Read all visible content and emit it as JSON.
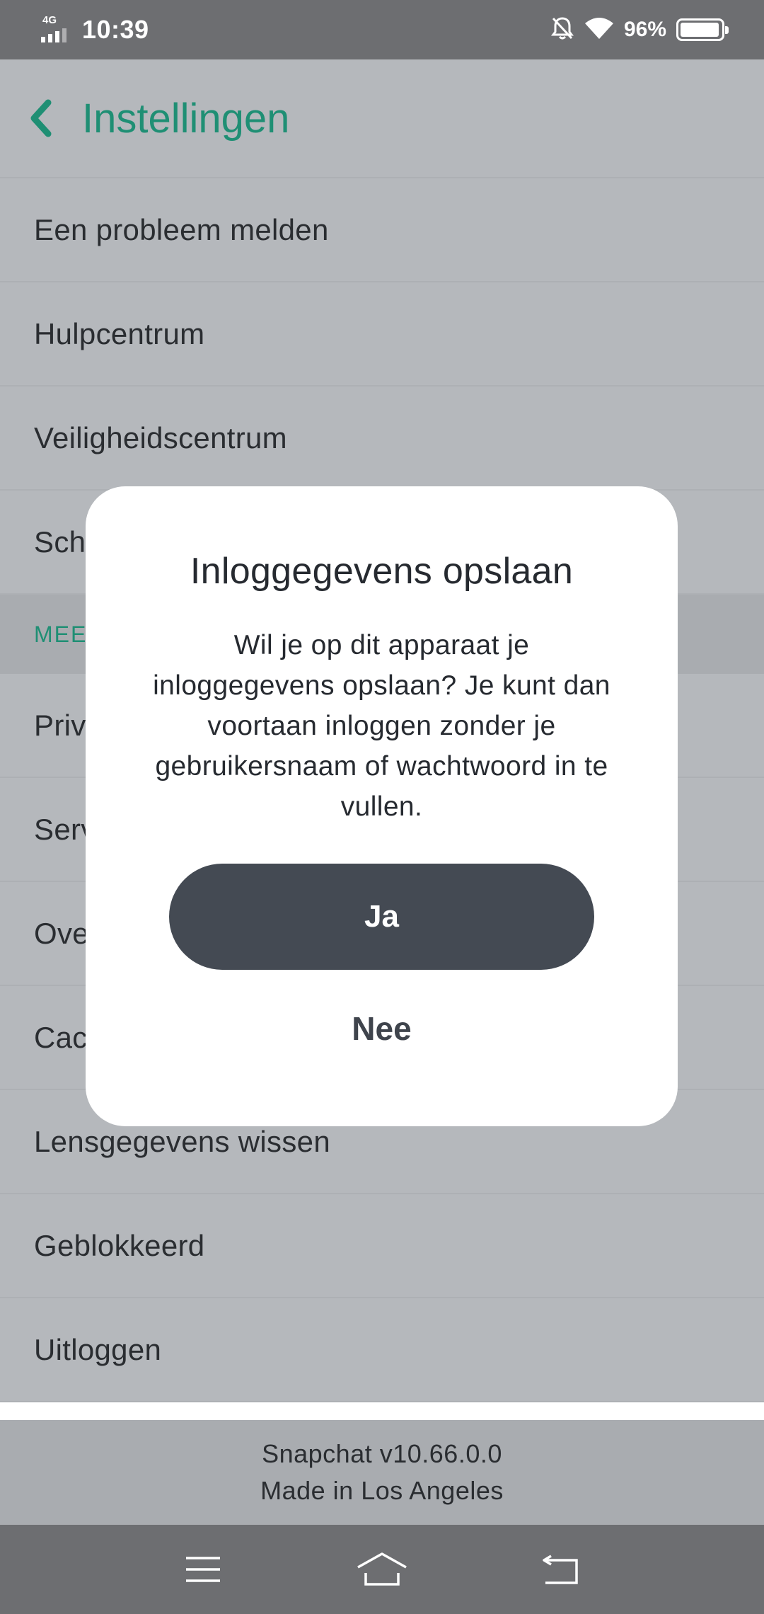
{
  "status_bar": {
    "network": "4G",
    "time": "10:39",
    "battery_percent": "96%",
    "battery_level": 0.96,
    "icons": [
      "signal-icon",
      "bell-off-icon",
      "wifi-icon",
      "battery-icon"
    ]
  },
  "header": {
    "title": "Instellingen",
    "back_icon": "chevron-left-icon"
  },
  "list": {
    "rows_top": [
      "Een probleem melden",
      "Hulpcentrum",
      "Veiligheidscentrum",
      "Sch"
    ],
    "section_header": "MEE",
    "rows_bottom": [
      "Priv",
      "Serv",
      "Ove",
      "Cac",
      "Lensgegevens wissen",
      "Geblokkeerd",
      "Uitloggen"
    ]
  },
  "footer": {
    "version": "Snapchat v10.66.0.0",
    "made_in": "Made in Los Angeles"
  },
  "dialog": {
    "title": "Inloggegevens opslaan",
    "message": "Wil je op dit apparaat je inloggegevens opslaan? Je kunt dan voortaan inloggen zonder je gebruikersnaam of wachtwoord in te vullen.",
    "yes_label": "Ja",
    "no_label": "Nee"
  },
  "nav_bar": {
    "icons": [
      "menu-icon",
      "home-icon",
      "back-icon"
    ]
  },
  "colors": {
    "accent": "#1f8f74",
    "overlay_bg": "#b5b8bc",
    "button_dark": "#444a53",
    "system_bar": "#6d6e71"
  }
}
